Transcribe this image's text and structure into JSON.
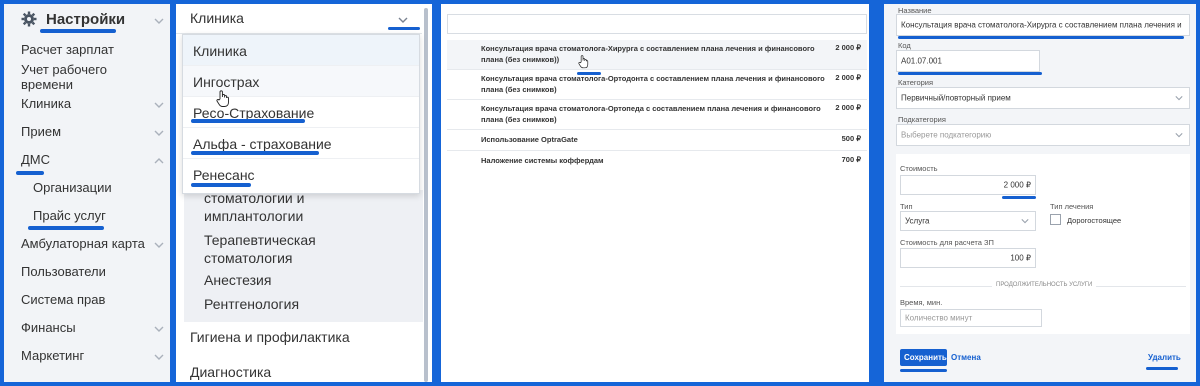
{
  "colors": {
    "accent": "#1560d0",
    "sidebar_bg": "#f2f4f7",
    "form_bg": "#f3f5f8"
  },
  "sidebar": {
    "header": "Настройки",
    "items": [
      {
        "label": "Расчет зарплат"
      },
      {
        "label": "Учет рабочего"
      },
      {
        "label": "времени"
      },
      {
        "label": "Клиника"
      },
      {
        "label": "Прием"
      },
      {
        "label": "ДМС"
      },
      {
        "label": "Организации"
      },
      {
        "label": "Прайс услуг"
      },
      {
        "label": "Амбулаторная карта"
      },
      {
        "label": "Пользователи"
      },
      {
        "label": "Система прав"
      },
      {
        "label": "Финансы"
      },
      {
        "label": "Маркетинг"
      }
    ]
  },
  "clinic_select": {
    "value": "Клиника",
    "options": [
      "Клиника",
      "Ингострах",
      "Ресо-Страхование",
      "Альфа - страхование",
      "Ренесанс"
    ]
  },
  "categories": {
    "group_items": [
      "стоматологии и",
      "имплантологии",
      "Терапевтическая",
      "стоматология",
      "Анестезия",
      "Рентгенология"
    ],
    "top_items": [
      "Гигиена и профилактика",
      "Диагностика"
    ]
  },
  "services": [
    {
      "name": "Консультация врача стоматолога-Хирурга с составлением плана лечения и финансового плана (без снимков))",
      "price": "2 000 ₽"
    },
    {
      "name": "Консультация врача стоматолога-Ортодонта с составлением плана лечения и финансового плана (без снимков)",
      "price": "2 000 ₽"
    },
    {
      "name": "Консультация врача стоматолога-Ортопеда с составлением плана лечения и финансового плана (без снимков)",
      "price": "2 000 ₽"
    },
    {
      "name": "Использование OptraGate",
      "price": "500 ₽"
    },
    {
      "name": "Наложение системы коффердам",
      "price": "700 ₽"
    }
  ],
  "form": {
    "name_label": "Название",
    "name_value": "Консультация врача стоматолога-Хирурга с составлением плана лечения и",
    "code_label": "Код",
    "code_value": "A01.07.001",
    "category_label": "Категория",
    "category_value": "Первичный/повторный прием",
    "subcategory_label": "Подкатегория",
    "subcategory_placeholder": "Выберете подкатегорию",
    "cost_label": "Стоимость",
    "cost_value": "2 000 ₽",
    "type_label": "Тип",
    "type_value": "Услуга",
    "treatment_type_label": "Тип лечения",
    "expensive_label": "Дорогостоящее",
    "salary_cost_label": "Стоимость для расчета ЗП",
    "salary_cost_value": "100 ₽",
    "duration_section": "ПРОДОЛЖИТЕЛЬНОСТЬ УСЛУГИ",
    "time_label": "Время, мин.",
    "time_placeholder": "Количество минут",
    "save": "Сохранить",
    "cancel": "Отмена",
    "delete": "Удалить"
  }
}
